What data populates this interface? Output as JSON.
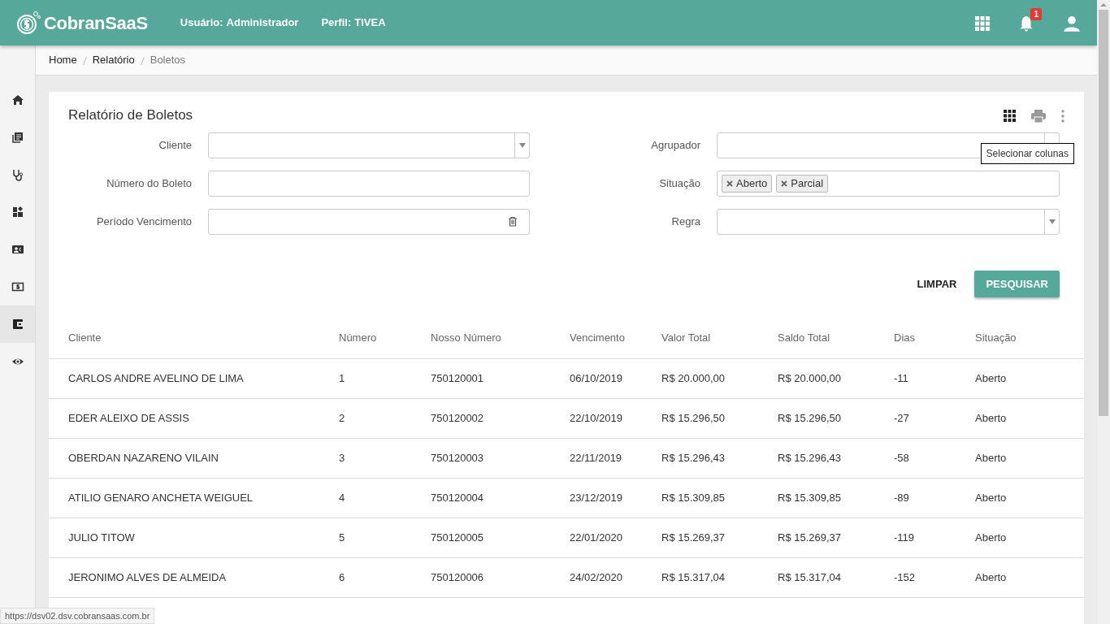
{
  "header": {
    "logo": "CobranSaaS",
    "user_label": "Usuário:",
    "user_value": "Administrador",
    "profile_label": "Perfil:",
    "profile_value": "TIVEA",
    "notification_count": "1"
  },
  "sidebar": {
    "items": [
      {
        "selected": false
      },
      {
        "selected": false
      },
      {
        "selected": false
      },
      {
        "selected": false
      },
      {
        "selected": false
      },
      {
        "selected": false
      },
      {
        "selected": true
      },
      {
        "selected": false
      }
    ]
  },
  "breadcrumb": [
    "Home",
    "Relatório",
    "Boletos"
  ],
  "card": {
    "title": "Relatório de Boletos",
    "tooltip": "Selecionar colunas"
  },
  "filters": [
    {
      "label": "Cliente",
      "kind": "select"
    },
    {
      "label": "Agrupador",
      "kind": "select"
    },
    {
      "label": "Número do Boleto",
      "kind": "text"
    },
    {
      "label": "Situação",
      "kind": "tags",
      "tags": [
        "Aberto",
        "Parcial"
      ]
    },
    {
      "label": "Período Vencimento",
      "kind": "date"
    },
    {
      "label": "Regra",
      "kind": "select"
    }
  ],
  "buttons": {
    "clear": "LIMPAR",
    "search": "PESQUISAR"
  },
  "table": {
    "columns": [
      "Cliente",
      "Número",
      "Nosso Número",
      "Vencimento",
      "Valor Total",
      "Saldo Total",
      "Dias",
      "Situação"
    ],
    "rows": [
      [
        "CARLOS ANDRE AVELINO DE LIMA",
        "1",
        "750120001",
        "06/10/2019",
        "R$ 20.000,00",
        "R$ 20.000,00",
        "-11",
        "Aberto"
      ],
      [
        "EDER ALEIXO DE ASSIS",
        "2",
        "750120002",
        "22/10/2019",
        "R$ 15.296,50",
        "R$ 15.296,50",
        "-27",
        "Aberto"
      ],
      [
        "OBERDAN NAZARENO VILAIN",
        "3",
        "750120003",
        "22/11/2019",
        "R$ 15.296,43",
        "R$ 15.296,43",
        "-58",
        "Aberto"
      ],
      [
        "ATILIO GENARO ANCHETA WEIGUEL",
        "4",
        "750120004",
        "23/12/2019",
        "R$ 15.309,85",
        "R$ 15.309,85",
        "-89",
        "Aberto"
      ],
      [
        "JULIO TITOW",
        "5",
        "750120005",
        "22/01/2020",
        "R$ 15.269,37",
        "R$ 15.269,37",
        "-119",
        "Aberto"
      ],
      [
        "JERONIMO ALVES DE ALMEIDA",
        "6",
        "750120006",
        "24/02/2020",
        "R$ 15.317,04",
        "R$ 15.317,04",
        "-152",
        "Aberto"
      ]
    ]
  },
  "status_url": "https://dsv02.dsv.cobransaas.com.br"
}
